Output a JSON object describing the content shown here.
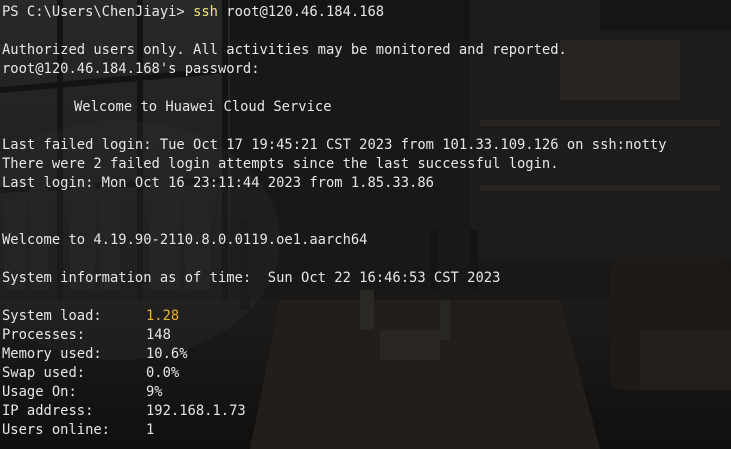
{
  "prompt_line": {
    "prompt": "PS C:\\Users\\ChenJiayi> ",
    "command": "ssh",
    "args": " root@120.46.184.168"
  },
  "auth_notice": "Authorized users only. All activities may be monitored and reported.",
  "password_prompt": "root@120.46.184.168's password:",
  "welcome_banner": "Welcome to Huawei Cloud Service",
  "last_failed": "Last failed login: Tue Oct 17 19:45:21 CST 2023 from 101.33.109.126 on ssh:notty",
  "failed_attempts": "There were 2 failed login attempts since the last successful login.",
  "last_login": "Last login: Mon Oct 16 23:11:44 2023 from 1.85.33.86",
  "kernel_welcome": "Welcome to 4.19.90-2110.8.0.0119.oe1.aarch64",
  "sysinfo_header": "System information as of time:  Sun Oct 22 16:46:53 CST 2023",
  "system_info": [
    {
      "key": "System load:",
      "value": "1.28",
      "highlight": true
    },
    {
      "key": "Processes:",
      "value": "148"
    },
    {
      "key": "Memory used:",
      "value": "10.6%"
    },
    {
      "key": "Swap used:",
      "value": "0.0%"
    },
    {
      "key": "Usage On:",
      "value": "9%"
    },
    {
      "key": "IP address:",
      "value": "192.168.1.73"
    },
    {
      "key": "Users online:",
      "value": "1"
    }
  ],
  "colors": {
    "text": "#e6e6e6",
    "command": "#f5e46a",
    "load_highlight": "#e8b23a"
  }
}
